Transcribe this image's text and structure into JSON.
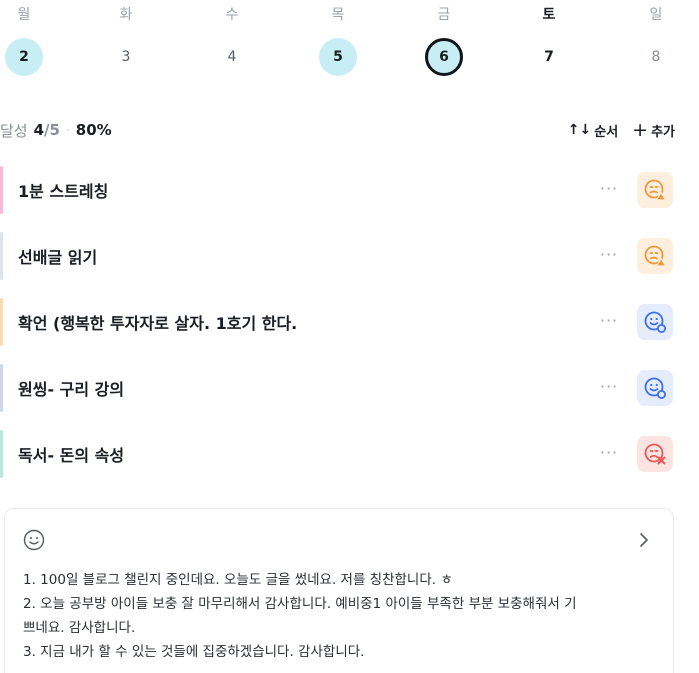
{
  "week": [
    {
      "name": "월",
      "num": "2",
      "state": "done",
      "name_style": "normal"
    },
    {
      "name": "화",
      "num": "3",
      "state": "normal",
      "name_style": "normal"
    },
    {
      "name": "수",
      "num": "4",
      "state": "normal",
      "name_style": "normal"
    },
    {
      "name": "목",
      "num": "5",
      "state": "done",
      "name_style": "normal"
    },
    {
      "name": "금",
      "num": "6",
      "state": "today",
      "name_style": "normal"
    },
    {
      "name": "토",
      "num": "7",
      "state": "dark",
      "name_style": "bold"
    },
    {
      "name": "일",
      "num": "8",
      "state": "light",
      "name_style": "normal"
    }
  ],
  "summary": {
    "label": "달성",
    "count": "4",
    "total": "/5",
    "separator": "·",
    "percent": "80%"
  },
  "actions": {
    "order_icon": "↑↓",
    "order_label": "순서",
    "add_icon": "+",
    "add_label": "추가"
  },
  "habits": [
    {
      "title": "1분 스트레칭",
      "accent": "#f6b8db",
      "status": "warn",
      "status_icon": "worried-face-warning-icon"
    },
    {
      "title": "선배글 읽기",
      "accent": "#dfe2e6",
      "status": "warn",
      "status_icon": "worried-face-warning-icon"
    },
    {
      "title": "확언 (행복한 투자자로 살자. 1호기 한다.",
      "accent": "#f9dcb0",
      "status": "ok",
      "status_icon": "smile-check-icon"
    },
    {
      "title": "원씽- 구리 강의",
      "accent": "#cfd6ea",
      "status": "ok",
      "status_icon": "smile-check-icon"
    },
    {
      "title": "독서- 돈의 속성",
      "accent": "#b8e7dc",
      "status": "fail",
      "status_icon": "sad-face-x-icon"
    }
  ],
  "more_label": "···",
  "colors": {
    "warn": "#f0983a",
    "ok": "#3b6ef0",
    "fail": "#e8584e",
    "done_day": "#c6eef4"
  },
  "note": {
    "icon": "smile-icon",
    "chevron": "chevron-right-icon",
    "lines": [
      "1. 100일 블로그 챌린지 중인데요. 오늘도 글을 썼네요. 저를 칭찬합니다. ㅎ",
      "2. 오늘 공부방 아이들 보충 잘 마무리해서 감사합니다. 예비중1 아이들 부족한 부분 보충해줘서 기",
      "쁘네요. 감사합니다.",
      "3. 지금 내가 할 수 있는 것들에 집중하겠습니다. 감사합니다."
    ]
  }
}
